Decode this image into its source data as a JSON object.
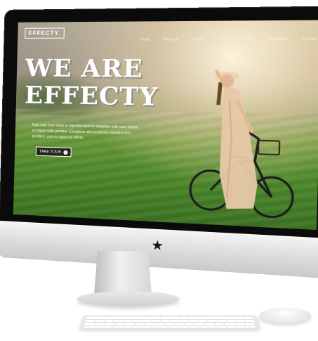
{
  "website": {
    "logo": "EFFECTY.",
    "nav": [
      "Home",
      "About Us",
      "Service",
      "Portfolio",
      "Blog",
      "Shortcodes",
      "Contact"
    ],
    "headline": {
      "line1": "WE ARE",
      "line2": "EFFECTY"
    },
    "paragraph": "Duis aute irure dolor in reprehenderit in voluptate velit esse dolore eu fugiat nulla pariatur. Excepteur sint occaecat cupidatat non proident, sunt in culpa qui officia.",
    "button_label": "TAKE TOUR",
    "button_icon": "arrow-right-icon"
  },
  "device": {
    "logo_glyph": "★",
    "colors": {
      "bezel": "#0b0b0b",
      "chin": "#dcdcdc",
      "grass": "#4f8a2c",
      "sky": "#cfc6b4"
    }
  }
}
